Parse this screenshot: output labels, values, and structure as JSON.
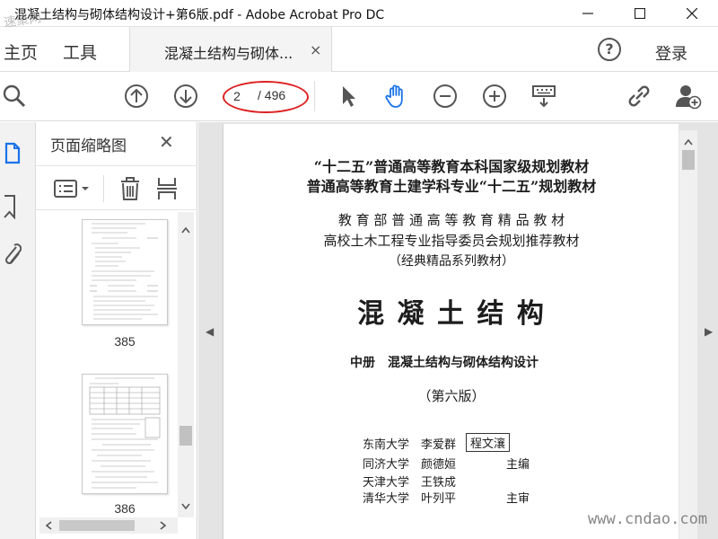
{
  "window": {
    "title": "混凝土结构与砌体结构设计+第6版.pdf - Adobe Acrobat Pro DC",
    "watermark_top_left": "速聚网",
    "controls": {
      "minimize_icon": "minimize-icon",
      "maximize_icon": "maximize-icon",
      "close_icon": "close-icon"
    }
  },
  "tabs": {
    "home": "主页",
    "tools": "工具",
    "document": "混凝土结构与砌体...",
    "document_close": "×",
    "help": "?",
    "login": "登录"
  },
  "toolbar": {
    "icons": [
      "search-icon",
      "page-up-icon",
      "page-down-icon",
      "select-arrow-icon",
      "hand-tool-icon",
      "zoom-out-icon",
      "zoom-in-icon",
      "keyboard-icon",
      "share-link-icon",
      "add-user-icon"
    ],
    "current_page": "2",
    "total_pages": "/ 496",
    "highlight_color": "#d22222",
    "accent_color": "#1a73e8"
  },
  "left_rail": {
    "icons": [
      "page-thumbnails-icon",
      "bookmark-icon",
      "attachment-icon"
    ]
  },
  "thumbnail_panel": {
    "title": "页面缩略图",
    "close": "✕",
    "pages": [
      {
        "number": "385"
      },
      {
        "number": "386"
      }
    ]
  },
  "document": {
    "line1": "“十二五”普通高等教育本科国家级规划教材",
    "line2": "普通高等教育土建学科专业“十二五”规划教材",
    "line3": "教 育 部 普 通 高 等 教 育 精 品 教 材",
    "line4": "高校土木工程专业指导委员会规划推荐教材",
    "line5": "（经典精品系列教材）",
    "main_title": "混 凝 土 结 构",
    "volume": "中册",
    "subtitle": "混凝土结构与砌体结构设计",
    "edition": "（第六版）",
    "authors": [
      {
        "school": "东南大学",
        "name": "李爱群",
        "name2": "程文瀼",
        "role": ""
      },
      {
        "school": "同济大学",
        "name": "颜德姮",
        "name2": "",
        "role": "主编"
      },
      {
        "school": "天津大学",
        "name": "王铁成",
        "name2": "",
        "role": ""
      },
      {
        "school": "清华大学",
        "name": "叶列平",
        "name2": "",
        "role": "主审"
      }
    ]
  },
  "watermark_bottom_right": "www.cndao.com"
}
